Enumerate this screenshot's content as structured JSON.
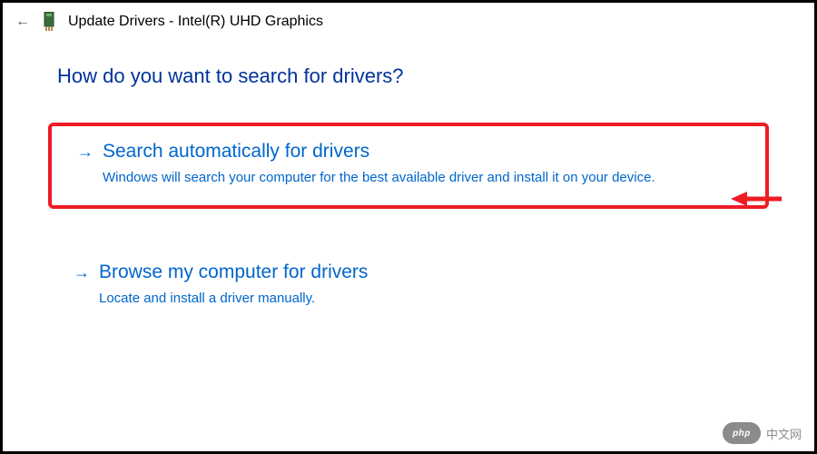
{
  "titlebar": {
    "title": "Update Drivers - Intel(R) UHD Graphics"
  },
  "heading": "How do you want to search for drivers?",
  "options": [
    {
      "title": "Search automatically for drivers",
      "description": "Windows will search your computer for the best available driver and install it on your device.",
      "highlighted": true
    },
    {
      "title": "Browse my computer for drivers",
      "description": "Locate and install a driver manually.",
      "highlighted": false
    }
  ],
  "watermark": {
    "pill": "php",
    "text": "中文网"
  }
}
